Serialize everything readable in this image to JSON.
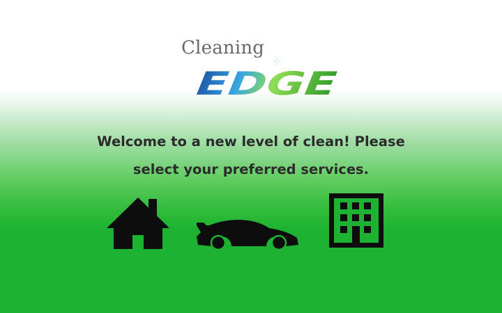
{
  "brand": {
    "word_top": "Cleaning",
    "word_bottom": "EDGE",
    "edge_colors": {
      "blue_dark": "#1c56a8",
      "blue_light": "#39a8e0",
      "green_light": "#8fdc55",
      "green_dark": "#2e9a2a"
    }
  },
  "welcome": {
    "line1": "Welcome to a new level of clean! Please",
    "line2": "select your preferred services."
  },
  "services": [
    {
      "icon": "house-icon",
      "key": "home"
    },
    {
      "icon": "car-icon",
      "key": "car"
    },
    {
      "icon": "office-building-icon",
      "key": "office"
    }
  ],
  "colors": {
    "background_top": "#ffffff",
    "background_bottom": "#1eb232",
    "text": "#2b2b2b",
    "icon": "#0d0d0d"
  }
}
